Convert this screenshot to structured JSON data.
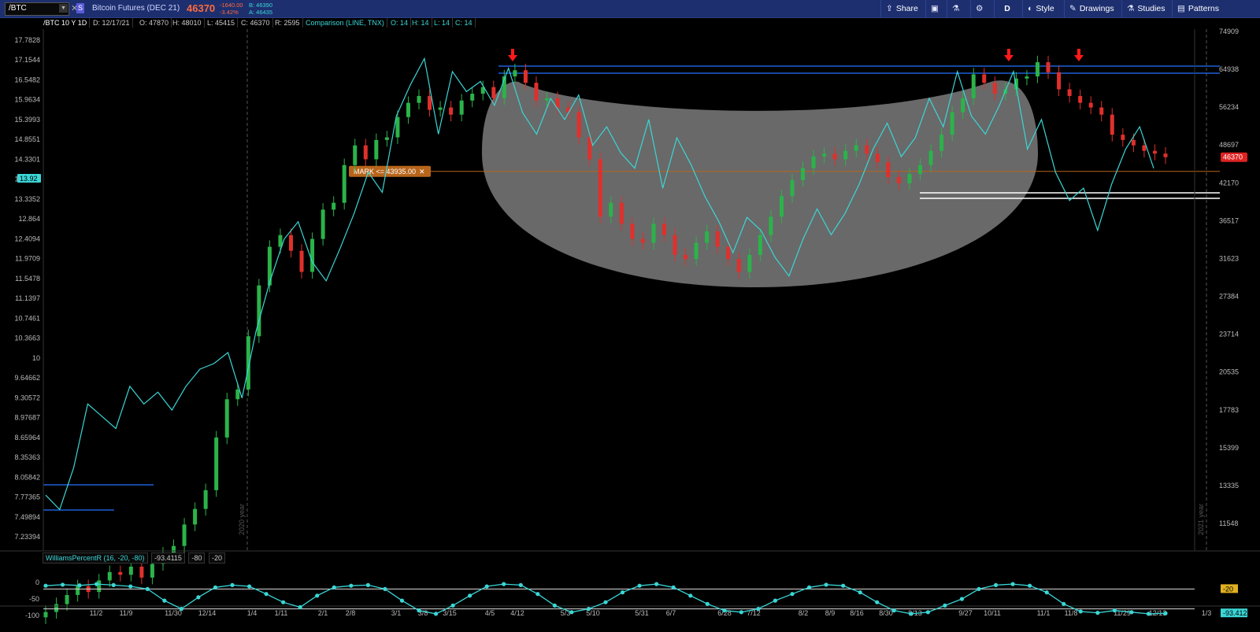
{
  "toolbar": {
    "symbol": "/BTC",
    "symbol_badge": "S",
    "description": "Bitcoin Futures (DEC 21)",
    "last": "46370",
    "change": "-1640.00",
    "change_pct": "-3.42%",
    "bid": "B: 46390",
    "ask": "A: 46435",
    "share_label": "Share",
    "aggregation_label": "D",
    "style_label": "Style",
    "drawings_label": "Drawings",
    "studies_label": "Studies",
    "patterns_label": "Patterns"
  },
  "info_bar": {
    "chart_label": "/BTC 10 Y 1D",
    "date": "D: 12/17/21",
    "open": "O: 47870",
    "high": "H: 48010",
    "low": "L: 45415",
    "close": "C: 46370",
    "range": "R: 2595",
    "comparison": "Comparison (LINE, TNX)",
    "cmp_open": "O: 14",
    "cmp_high": "H: 14",
    "cmp_low": "L: 14",
    "cmp_close": "C: 14"
  },
  "chart_data": {
    "type": "candlestick",
    "left_axis_ticks": [
      "17.7828",
      "17.1544",
      "16.5482",
      "15.9634",
      "15.3993",
      "14.8551",
      "14.3301",
      "13.8237",
      "13.3352",
      "12.864",
      "12.4094",
      "11.9709",
      "11.5478",
      "11.1397",
      "10.7461",
      "10.3663",
      "10",
      "9.64662",
      "9.30572",
      "8.97687",
      "8.65964",
      "8.35363",
      "8.05842",
      "7.77365",
      "7.49894",
      "7.23394"
    ],
    "right_axis_ticks": [
      "74909",
      "64938",
      "56234",
      "48697",
      "42170",
      "36517",
      "31623",
      "27384",
      "23714",
      "20535",
      "17783",
      "15399",
      "13335",
      "11548"
    ],
    "x_ticks": [
      "11/2",
      "11/9",
      "11/30",
      "12/14",
      "1/4",
      "1/11",
      "2/1",
      "2/8",
      "3/1",
      "3/8",
      "3/15",
      "4/5",
      "4/12",
      "5/3",
      "5/10",
      "5/31",
      "6/7",
      "6/28",
      "7/12",
      "8/2",
      "8/9",
      "8/16",
      "8/30",
      "9/13",
      "9/27",
      "10/11",
      "11/1",
      "11/8",
      "11/29",
      "12/13",
      "1/3"
    ],
    "year_labels": [
      "2020 year",
      "2021 year"
    ],
    "left_marker": "13.92",
    "price_marker": "46370",
    "mark_label": "MARK <= 43935.00",
    "mark_price": 43935,
    "btc_closes": [
      8250,
      8500,
      8800,
      9100,
      8900,
      9300,
      9600,
      9500,
      9800,
      9400,
      9900,
      10300,
      10600,
      11500,
      12200,
      13100,
      16000,
      18500,
      19200,
      23500,
      28500,
      33000,
      34500,
      32500,
      30000,
      34000,
      38000,
      39000,
      45000,
      48500,
      46000,
      49500,
      50000,
      54000,
      57000,
      58500,
      55500,
      56000,
      54500,
      57500,
      59000,
      60500,
      58000,
      63000,
      64500,
      61500,
      57500,
      58000,
      56000,
      55000,
      50000,
      46000,
      37000,
      39000,
      36000,
      34000,
      33500,
      36000,
      34500,
      32000,
      31500,
      33500,
      35000,
      33000,
      31500,
      30000,
      32000,
      34500,
      37000,
      40000,
      42500,
      44500,
      46500,
      47000,
      46000,
      47500,
      48500,
      47000,
      45500,
      43000,
      42000,
      43500,
      45000,
      47500,
      50500,
      55000,
      58000,
      63500,
      61500,
      59000,
      60000,
      62500,
      63000,
      66500,
      64000,
      60000,
      58500,
      57000,
      56000,
      54500,
      50500,
      49500,
      48500,
      47500,
      47000,
      46370
    ],
    "tnx_line": [
      7.8,
      7.6,
      8.2,
      9.2,
      9.0,
      8.8,
      9.5,
      9.2,
      9.4,
      9.1,
      9.5,
      9.8,
      9.9,
      10.1,
      9.3,
      10.5,
      11.5,
      12.4,
      12.8,
      11.9,
      11.5,
      12.2,
      13.0,
      14.0,
      13.5,
      15.5,
      16.4,
      17.2,
      15.0,
      16.8,
      16.2,
      16.5,
      15.8,
      16.9,
      15.6,
      15.0,
      16.0,
      15.4,
      16.1,
      14.7,
      15.2,
      14.5,
      14.1,
      15.4,
      13.6,
      14.9,
      14.2,
      13.4,
      12.8,
      12.1,
      12.9,
      12.6,
      12.0,
      11.6,
      12.4,
      13.1,
      12.5,
      13.0,
      13.7,
      14.6,
      15.3,
      14.4,
      14.9,
      16.0,
      15.2,
      16.8,
      15.5,
      15.0,
      15.8,
      16.8,
      14.6,
      15.4,
      14.0,
      13.3,
      13.6,
      12.6,
      13.7,
      14.6,
      15.2,
      14.1
    ],
    "williams_r": [
      -10,
      -7,
      -9,
      -5,
      -8,
      -12,
      -20,
      -55,
      -80,
      -45,
      -15,
      -8,
      -12,
      -35,
      -60,
      -75,
      -40,
      -15,
      -10,
      -8,
      -20,
      -55,
      -85,
      -95,
      -70,
      -40,
      -12,
      -5,
      -8,
      -35,
      -70,
      -90,
      -80,
      -60,
      -30,
      -10,
      -5,
      -15,
      -40,
      -65,
      -85,
      -90,
      -80,
      -55,
      -35,
      -15,
      -7,
      -10,
      -30,
      -60,
      -85,
      -95,
      -90,
      -70,
      -50,
      -20,
      -8,
      -5,
      -10,
      -30,
      -65,
      -88,
      -92,
      -85,
      -90,
      -95,
      -93.41
    ],
    "wpr_axis_ticks": [
      "0",
      "-50",
      "-100"
    ],
    "wpr_markers": [
      "-20",
      "-93.412"
    ]
  },
  "studies": {
    "wpr_name": "WilliamsPercentR (16, -20, -80)",
    "wpr_value": "-93.4115",
    "wpr_os": "-80",
    "wpr_ob": "-20"
  },
  "colors": {
    "up": "#2bb34a",
    "down": "#e0302c",
    "comparison": "#3bd6d6",
    "levels": "#1f5fd6",
    "mark": "#b8651b",
    "ellipse": "#8c8c8c"
  }
}
